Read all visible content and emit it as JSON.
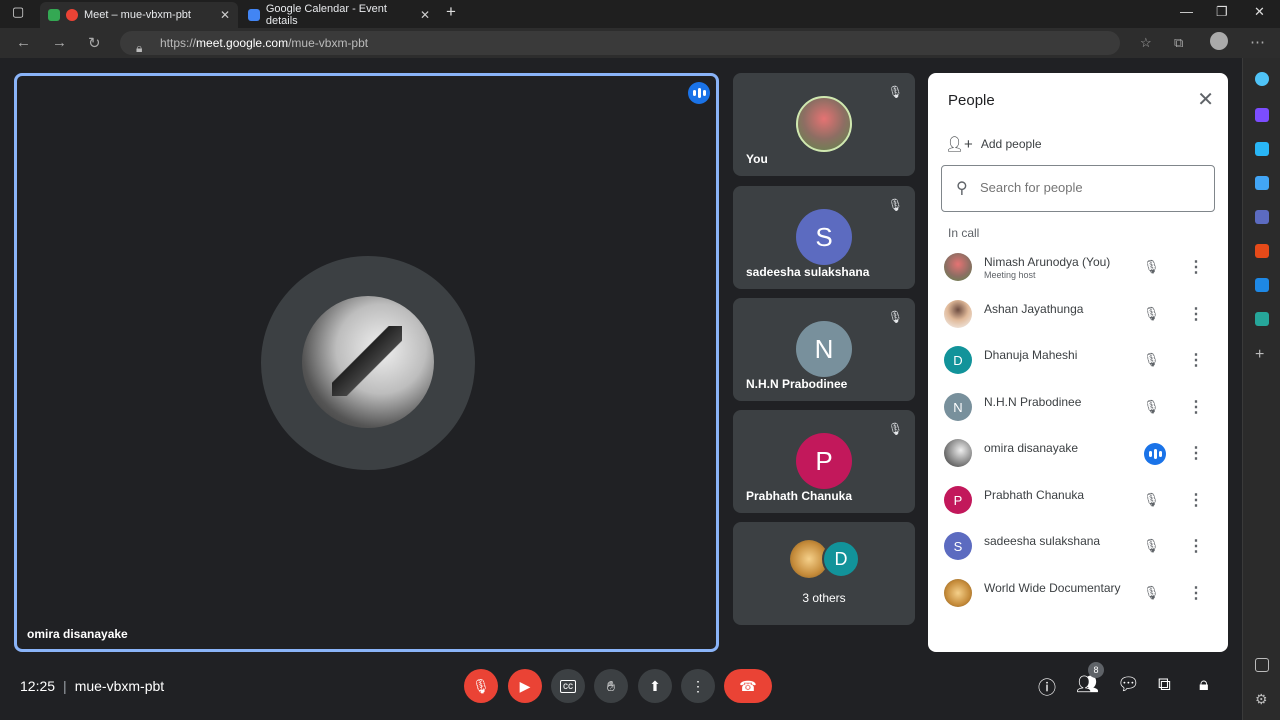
{
  "browser": {
    "tabs": [
      {
        "title": "Meet – mue-vbxm-pbt"
      },
      {
        "title": "Google Calendar - Event details"
      }
    ],
    "url_prefix": "https://",
    "url_host": "meet.google.com",
    "url_path": "/mue-vbxm-pbt"
  },
  "main_tile": {
    "name": "omira disanayake"
  },
  "side_tiles": [
    {
      "name": "You",
      "initial": "",
      "color": "#d0685c"
    },
    {
      "name": "sadeesha sulakshana",
      "initial": "S",
      "color": "#5c6bc0"
    },
    {
      "name": "N.H.N Prabodinee",
      "initial": "N",
      "color": "#78909c"
    },
    {
      "name": "Prabhath Chanuka",
      "initial": "P",
      "color": "#c2185b"
    }
  ],
  "others_tile": {
    "label": "3 others",
    "initial": "D"
  },
  "panel": {
    "title": "People",
    "add_label": "Add people",
    "search_placeholder": "Search for people",
    "section_label": "In call",
    "participants": [
      {
        "name": "Nimash Arunodya (You)",
        "sub": "Meeting host",
        "initial": "",
        "color": "#d0685c"
      },
      {
        "name": "Ashan Jayathunga",
        "sub": "",
        "initial": "",
        "color": "#e8d5c0"
      },
      {
        "name": "Dhanuja Maheshi",
        "sub": "",
        "initial": "D",
        "color": "#12939a"
      },
      {
        "name": "N.H.N Prabodinee",
        "sub": "",
        "initial": "N",
        "color": "#78909c"
      },
      {
        "name": "omira disanayake",
        "sub": "",
        "initial": "",
        "color": "#555555"
      },
      {
        "name": "Prabhath Chanuka",
        "sub": "",
        "initial": "P",
        "color": "#c2185b"
      },
      {
        "name": "sadeesha sulakshana",
        "sub": "",
        "initial": "S",
        "color": "#5c6bc0"
      },
      {
        "name": "World Wide Documentary",
        "sub": "",
        "initial": "",
        "color": "#c58b3a"
      }
    ]
  },
  "bottom": {
    "time": "12:25",
    "meeting_code": "mue-vbxm-pbt",
    "people_count": "8"
  }
}
